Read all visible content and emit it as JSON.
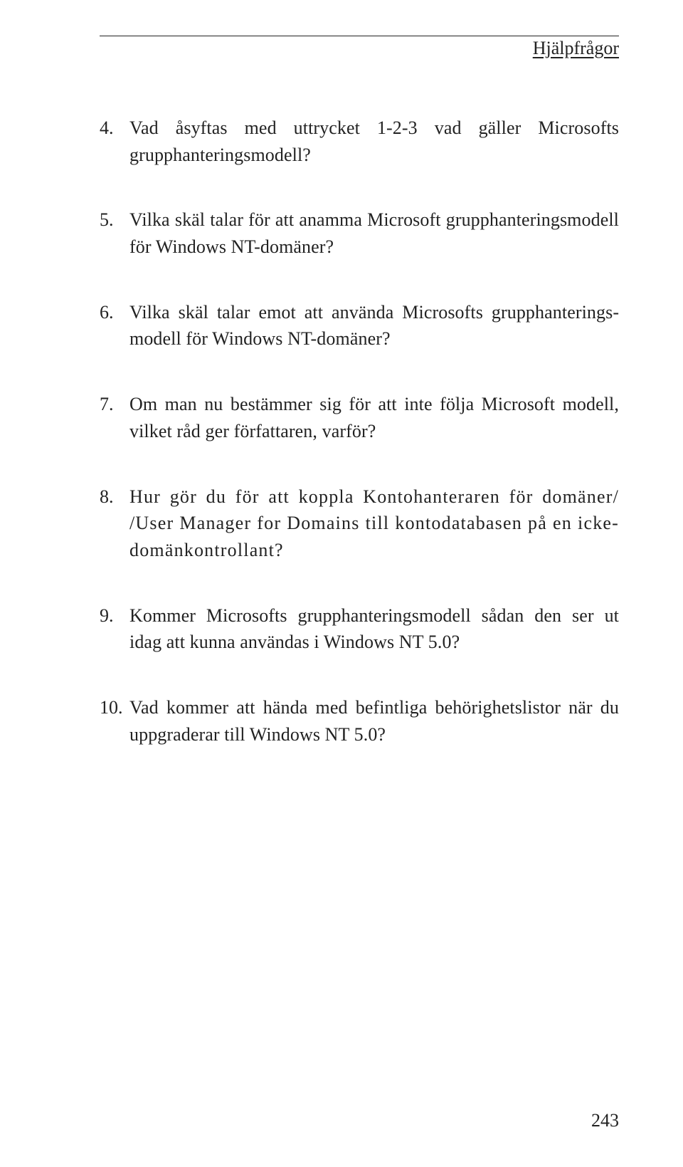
{
  "header": {
    "section_title": "Hjälpfrågor"
  },
  "questions": [
    {
      "num": "4.",
      "text": "Vad åsyftas med uttrycket 1-2-3 vad gäller Microsofts grupphanteringsmodell?"
    },
    {
      "num": "5.",
      "text": "Vilka skäl talar för att anamma Microsoft grupphanterings­modell för Windows NT-domäner?"
    },
    {
      "num": "6.",
      "text": "Vilka skäl talar emot att använda Microsofts grupphanterings­modell för Windows NT-domäner?"
    },
    {
      "num": "7.",
      "text": "Om man nu bestämmer sig för att inte följa Microsoft modell, vilket råd ger författaren, varför?"
    },
    {
      "num": "8.",
      "text": "Hur gör du för att koppla Kontohanteraren för domäner/ /User Manager for Domains till kontodatabasen på en icke-domänkontrollant?"
    },
    {
      "num": "9.",
      "text": "Kommer Microsofts grupphanteringsmodell sådan den ser ut idag att kunna användas i Windows NT 5.0?"
    },
    {
      "num": "10.",
      "text": "Vad kommer att hända med befintliga behörighetslistor när du uppgraderar till Windows NT 5.0?"
    }
  ],
  "page_number": "243"
}
